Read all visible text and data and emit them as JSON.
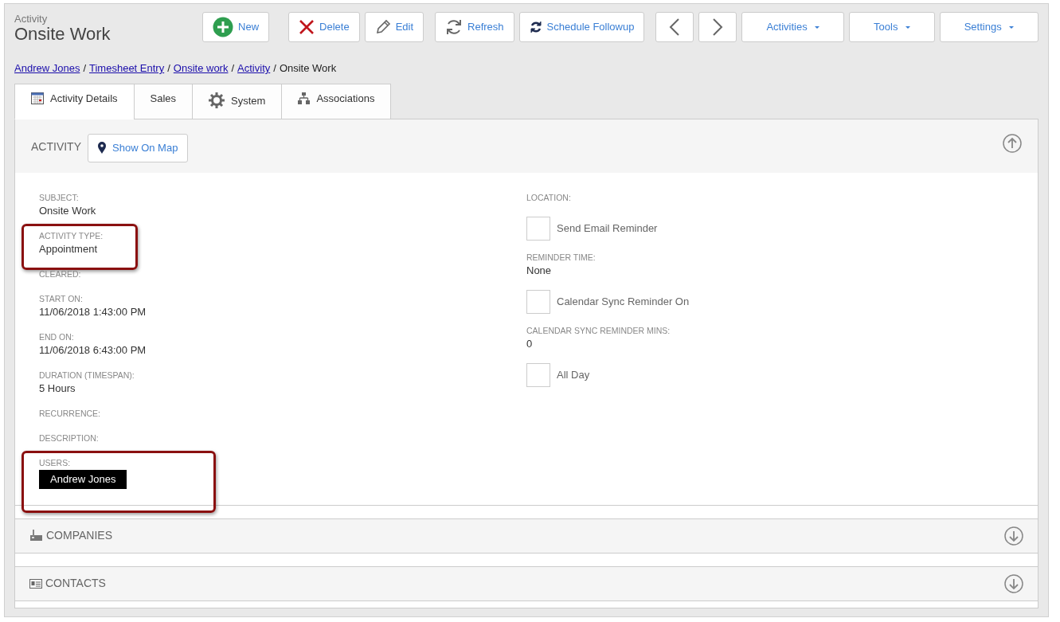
{
  "header": {
    "subtitle": "Activity",
    "title": "Onsite Work"
  },
  "toolbar": [
    {
      "kind": "button",
      "label": "New"
    },
    {
      "kind": "button",
      "label": "Delete"
    },
    {
      "kind": "button",
      "label": "Edit"
    },
    {
      "kind": "button",
      "label": "Refresh"
    },
    {
      "kind": "button",
      "label": "Schedule Followup"
    },
    {
      "kind": "nav"
    },
    {
      "kind": "nav"
    },
    {
      "kind": "dropdown",
      "label": "Activities"
    },
    {
      "kind": "dropdown",
      "label": "Tools"
    },
    {
      "kind": "dropdown",
      "label": "Settings"
    }
  ],
  "breadcrumb": [
    {
      "kind": "link",
      "label": "Andrew Jones"
    },
    {
      "kind": "separator",
      "label": "/"
    },
    {
      "kind": "link",
      "label": "Timesheet Entry"
    },
    {
      "kind": "separator",
      "label": "/"
    },
    {
      "kind": "link",
      "label": "Onsite work"
    },
    {
      "kind": "separator",
      "label": "/"
    },
    {
      "kind": "link",
      "label": "Activity"
    },
    {
      "kind": "separator",
      "label": "/"
    },
    {
      "kind": "current",
      "label": "Onsite Work"
    }
  ],
  "tabs": [
    {
      "label": "Activity Details",
      "selected": true
    },
    {
      "label": "Sales",
      "selected": false
    },
    {
      "label": "System",
      "selected": false
    },
    {
      "label": "Associations",
      "selected": false
    }
  ],
  "activity_panel": {
    "title": "ACTIVITY",
    "map_button": "Show On Map",
    "expanded": true,
    "left_fields": [
      {
        "kind": "field",
        "label": "SUBJECT:",
        "value": "Onsite Work",
        "highlighted": false
      },
      {
        "kind": "field",
        "label": "ACTIVITY TYPE:",
        "value": "Appointment",
        "highlighted": true
      },
      {
        "kind": "field",
        "label": "CLEARED:",
        "highlighted": false
      },
      {
        "kind": "field",
        "label": "START ON:",
        "value": "11/06/2018 1:43:00 PM",
        "highlighted": false
      },
      {
        "kind": "field",
        "label": "END ON:",
        "value": "11/06/2018 6:43:00 PM",
        "highlighted": false
      },
      {
        "kind": "field",
        "label": "DURATION (TIMESPAN):",
        "value": "5 Hours",
        "highlighted": false
      },
      {
        "kind": "field",
        "label": "RECURRENCE:",
        "highlighted": false
      },
      {
        "kind": "field",
        "label": "DESCRIPTION:",
        "highlighted": false
      },
      {
        "kind": "tags",
        "label": "USERS:",
        "value": "Andrew Jones",
        "highlighted": true
      }
    ],
    "right_fields": [
      {
        "kind": "field",
        "label": "LOCATION:"
      },
      {
        "kind": "checkbox",
        "label": "Send Email Reminder",
        "checked": false
      },
      {
        "kind": "field",
        "label": "REMINDER TIME:",
        "value": "None"
      },
      {
        "kind": "checkbox",
        "label": "Calendar Sync Reminder On",
        "checked": false
      },
      {
        "kind": "field",
        "label": "CALENDAR SYNC REMINDER MINS:",
        "value": "0"
      },
      {
        "kind": "checkbox",
        "label": "All Day",
        "checked": false
      }
    ]
  },
  "sections": [
    {
      "title": "COMPANIES",
      "expanded": false
    },
    {
      "title": "CONTACTS",
      "expanded": false
    }
  ]
}
